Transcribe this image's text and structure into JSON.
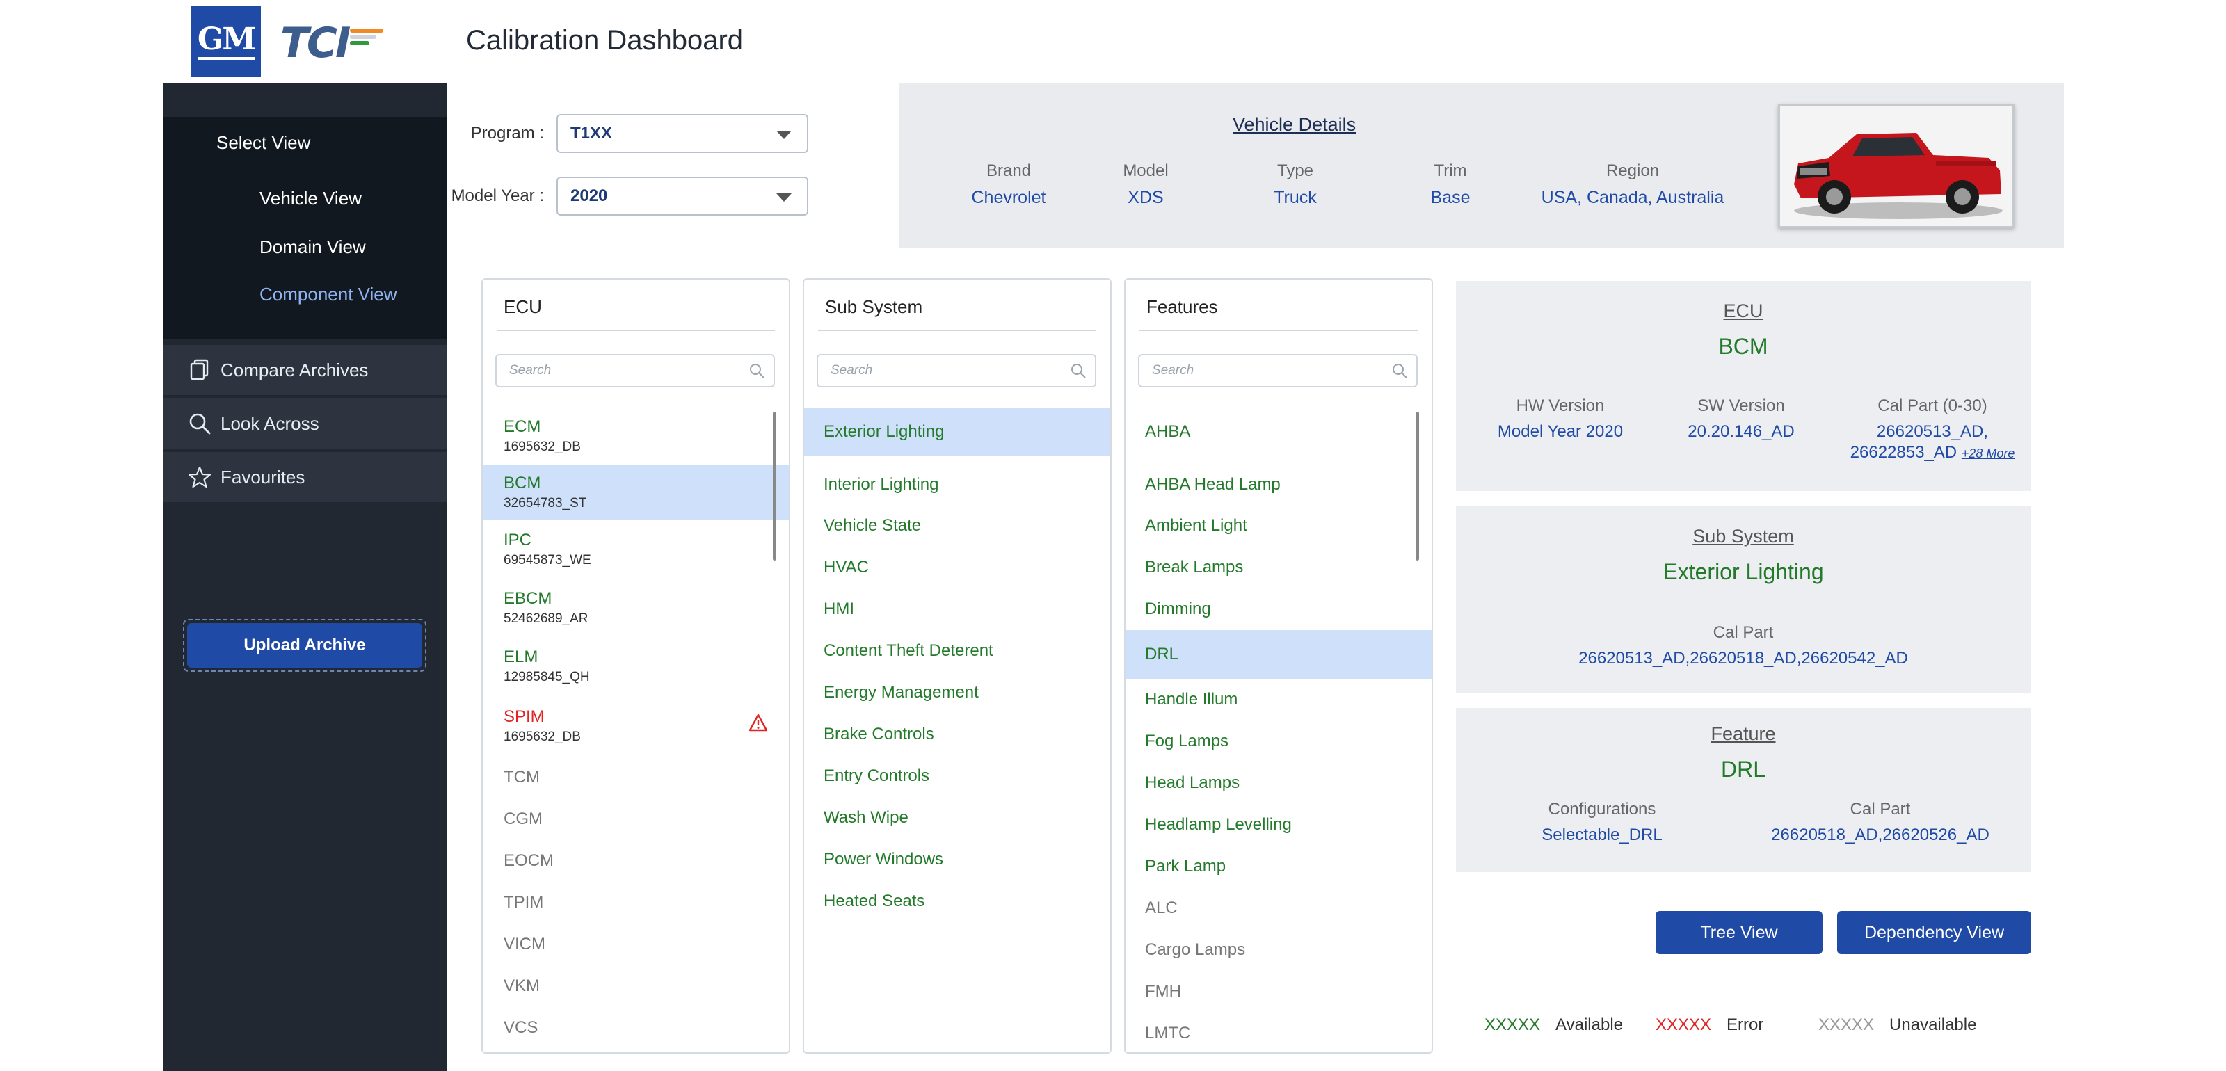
{
  "app": {
    "title": "Calibration Dashboard",
    "logo_gm": "GM",
    "logo_tci": "TCI"
  },
  "colors": {
    "brand_blue": "#1f4aa6",
    "available": "#237a2b",
    "error": "#e02424",
    "unavailable": "#777777",
    "selected_row": "#cfe0fb"
  },
  "sidebar": {
    "select_view_title": "Select View",
    "views": [
      "Vehicle View",
      "Domain View",
      "Component View"
    ],
    "active_view": "Component View",
    "menu": [
      {
        "label": "Compare Archives",
        "icon": "document-copy-icon"
      },
      {
        "label": "Look Across",
        "icon": "search-icon"
      },
      {
        "label": "Favourites",
        "icon": "star-icon"
      }
    ],
    "upload_label": "Upload Archive"
  },
  "filters": {
    "program_label": "Program :",
    "program_value": "T1XX",
    "model_year_label": "Model Year :",
    "model_year_value": "2020"
  },
  "vehicle": {
    "title": "Vehicle Details",
    "fields": [
      {
        "label": "Brand",
        "value": "Chevrolet"
      },
      {
        "label": "Model",
        "value": "XDS"
      },
      {
        "label": "Type",
        "value": "Truck"
      },
      {
        "label": "Trim",
        "value": "Base"
      },
      {
        "label": "Region",
        "value": "USA, Canada, Australia"
      }
    ]
  },
  "ecu_panel": {
    "title": "ECU",
    "search_placeholder": "Search",
    "items": [
      {
        "name": "ECM",
        "sub": "1695632_DB",
        "status": "available"
      },
      {
        "name": "BCM",
        "sub": "32654783_ST",
        "status": "available",
        "selected": true
      },
      {
        "name": "IPC",
        "sub": "69545873_WE",
        "status": "available"
      },
      {
        "name": "EBCM",
        "sub": "52462689_AR",
        "status": "available"
      },
      {
        "name": "ELM",
        "sub": "12985845_QH",
        "status": "available"
      },
      {
        "name": "SPIM",
        "sub": "1695632_DB",
        "status": "error"
      },
      {
        "name": "TCM",
        "status": "unavailable"
      },
      {
        "name": "CGM",
        "status": "unavailable"
      },
      {
        "name": "EOCM",
        "status": "unavailable"
      },
      {
        "name": "TPIM",
        "status": "unavailable"
      },
      {
        "name": "VICM",
        "status": "unavailable"
      },
      {
        "name": "VKM",
        "status": "unavailable"
      },
      {
        "name": "VCS",
        "status": "unavailable"
      }
    ]
  },
  "subsystem_panel": {
    "title": "Sub System",
    "search_placeholder": "Search",
    "items": [
      "Exterior Lighting",
      "Interior Lighting",
      "Vehicle State",
      "HVAC",
      "HMI",
      "Content Theft Deterent",
      "Energy Management",
      "Brake Controls",
      "Entry Controls",
      "Wash Wipe",
      "Power Windows",
      "Heated Seats"
    ],
    "selected": "Exterior Lighting"
  },
  "features_panel": {
    "title": "Features",
    "search_placeholder": "Search",
    "items": [
      {
        "name": "AHBA",
        "status": "available"
      },
      {
        "name": "AHBA Head Lamp",
        "status": "available"
      },
      {
        "name": "Ambient Light",
        "status": "available"
      },
      {
        "name": "Break Lamps",
        "status": "available"
      },
      {
        "name": "Dimming",
        "status": "available"
      },
      {
        "name": "DRL",
        "status": "available",
        "selected": true
      },
      {
        "name": "Handle Illum",
        "status": "available"
      },
      {
        "name": "Fog Lamps",
        "status": "available"
      },
      {
        "name": "Head Lamps",
        "status": "available"
      },
      {
        "name": "Headlamp Levelling",
        "status": "available"
      },
      {
        "name": "Park Lamp",
        "status": "available"
      },
      {
        "name": "ALC",
        "status": "unavailable"
      },
      {
        "name": "Cargo Lamps",
        "status": "unavailable"
      },
      {
        "name": "FMH",
        "status": "unavailable"
      },
      {
        "name": "LMTC",
        "status": "unavailable"
      }
    ]
  },
  "details": {
    "ecu": {
      "title": "ECU",
      "value": "BCM",
      "hw_label": "HW Version",
      "hw_value": "Model Year 2020",
      "sw_label": "SW Version",
      "sw_value": "20.20.146_AD",
      "cal_label": "Cal Part (0-30)",
      "cal_value_1": "26620513_AD,",
      "cal_value_2": "26622853_AD",
      "cal_more": "+28 More"
    },
    "subsystem": {
      "title": "Sub System",
      "value": "Exterior Lighting",
      "cal_label": "Cal Part",
      "cal_value": "26620513_AD,26620518_AD,26620542_AD"
    },
    "feature": {
      "title": "Feature",
      "value": "DRL",
      "config_label": "Configurations",
      "config_value": "Selectable_DRL",
      "cal_label": "Cal Part",
      "cal_value": "26620518_AD,26620526_AD"
    }
  },
  "actions": {
    "tree_view": "Tree View",
    "dependency_view": "Dependency View"
  },
  "legend": [
    {
      "sample": "XXXXX",
      "label": "Available"
    },
    {
      "sample": "XXXXX",
      "label": "Error"
    },
    {
      "sample": "XXXXX",
      "label": "Unavailable"
    }
  ]
}
